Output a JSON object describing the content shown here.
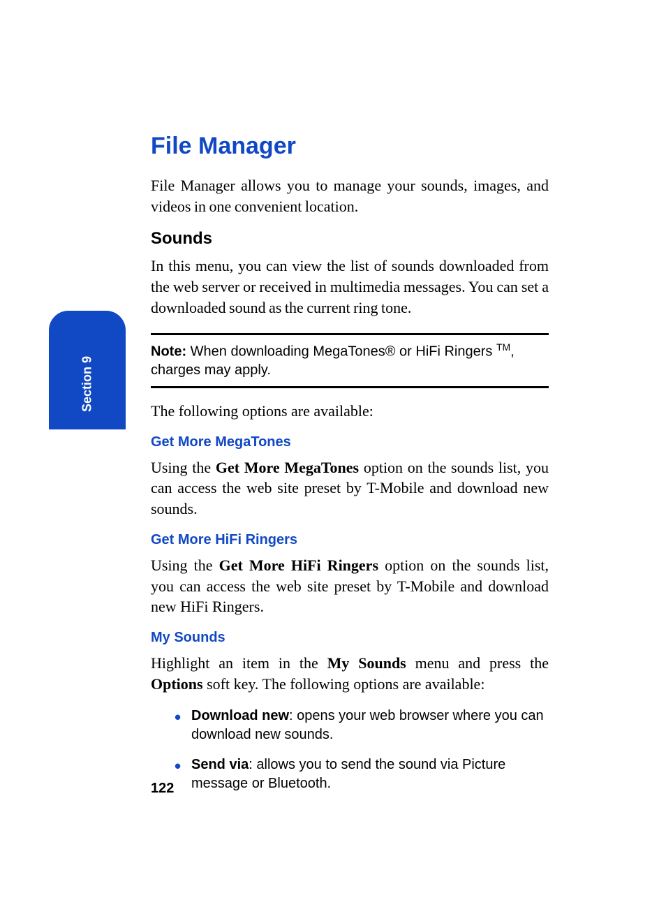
{
  "sectionTab": "Section 9",
  "title": "File Manager",
  "intro": "File Manager allows you to manage your sounds, images, and videos in one convenient location.",
  "sounds": {
    "heading": "Sounds",
    "body": "In this menu, you can view the list of sounds downloaded from the web server or received in multimedia messages. You can set a downloaded sound as the current ring tone."
  },
  "note": {
    "label": "Note:",
    "pre": " When downloading MegaTones® or HiFi Ringers ",
    "tm": "TM",
    "post": ", charges may apply."
  },
  "optionsIntro": "The following options are available:",
  "megatones": {
    "heading": "Get More MegaTones",
    "pre": "Using the ",
    "bold": "Get More MegaTones",
    "post": " option on the sounds list, you can access the web site preset by T-Mobile and download new sounds."
  },
  "hifi": {
    "heading": "Get More HiFi Ringers",
    "pre": "Using the ",
    "bold": "Get More HiFi Ringers",
    "post": " option on the sounds list, you can access the web site preset by T-Mobile and download new HiFi Ringers."
  },
  "mysounds": {
    "heading": "My Sounds",
    "p_pre1": "Highlight an item in the ",
    "p_bold1": "My Sounds",
    "p_mid": " menu and press the ",
    "p_bold2": "Options",
    "p_post": " soft key. The following options are available:"
  },
  "bullets": [
    {
      "label": "Download new",
      "text": ": opens your web browser where you can download new sounds."
    },
    {
      "label": "Send via",
      "text": ": allows you to send the sound via Picture message or Bluetooth."
    }
  ],
  "pageNumber": "122"
}
